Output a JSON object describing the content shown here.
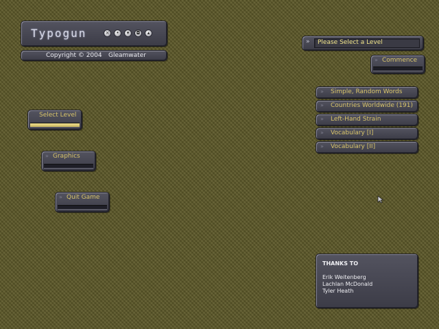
{
  "logo": {
    "title": "Typogun",
    "icons": [
      "close-icon",
      "settings-icon",
      "down-arrow-icon",
      "disk-icon",
      "eject-icon"
    ]
  },
  "copyright": {
    "text": "Copyright © 2004",
    "company": "Gleamwater"
  },
  "menu": {
    "select_level": "Select Level",
    "graphics": "Graphics",
    "quit": "Quit Game"
  },
  "level_dropdown": {
    "value": "Please Select a Level"
  },
  "commence": "Commence",
  "levels": [
    "Simple, Random Words",
    "Countries Worldwide (191)",
    "Left-Hand Strain",
    "Vocabulary [I]",
    "Vocabulary [II]"
  ],
  "thanks": {
    "title": "THANKS TO",
    "names": [
      "Erik Weitenberg",
      "Lachlan McDonald",
      "Tyler Heath"
    ]
  },
  "colors": {
    "accent": "#d8c46a",
    "panel": "#4a4a55",
    "background": "#5e5a2a"
  }
}
